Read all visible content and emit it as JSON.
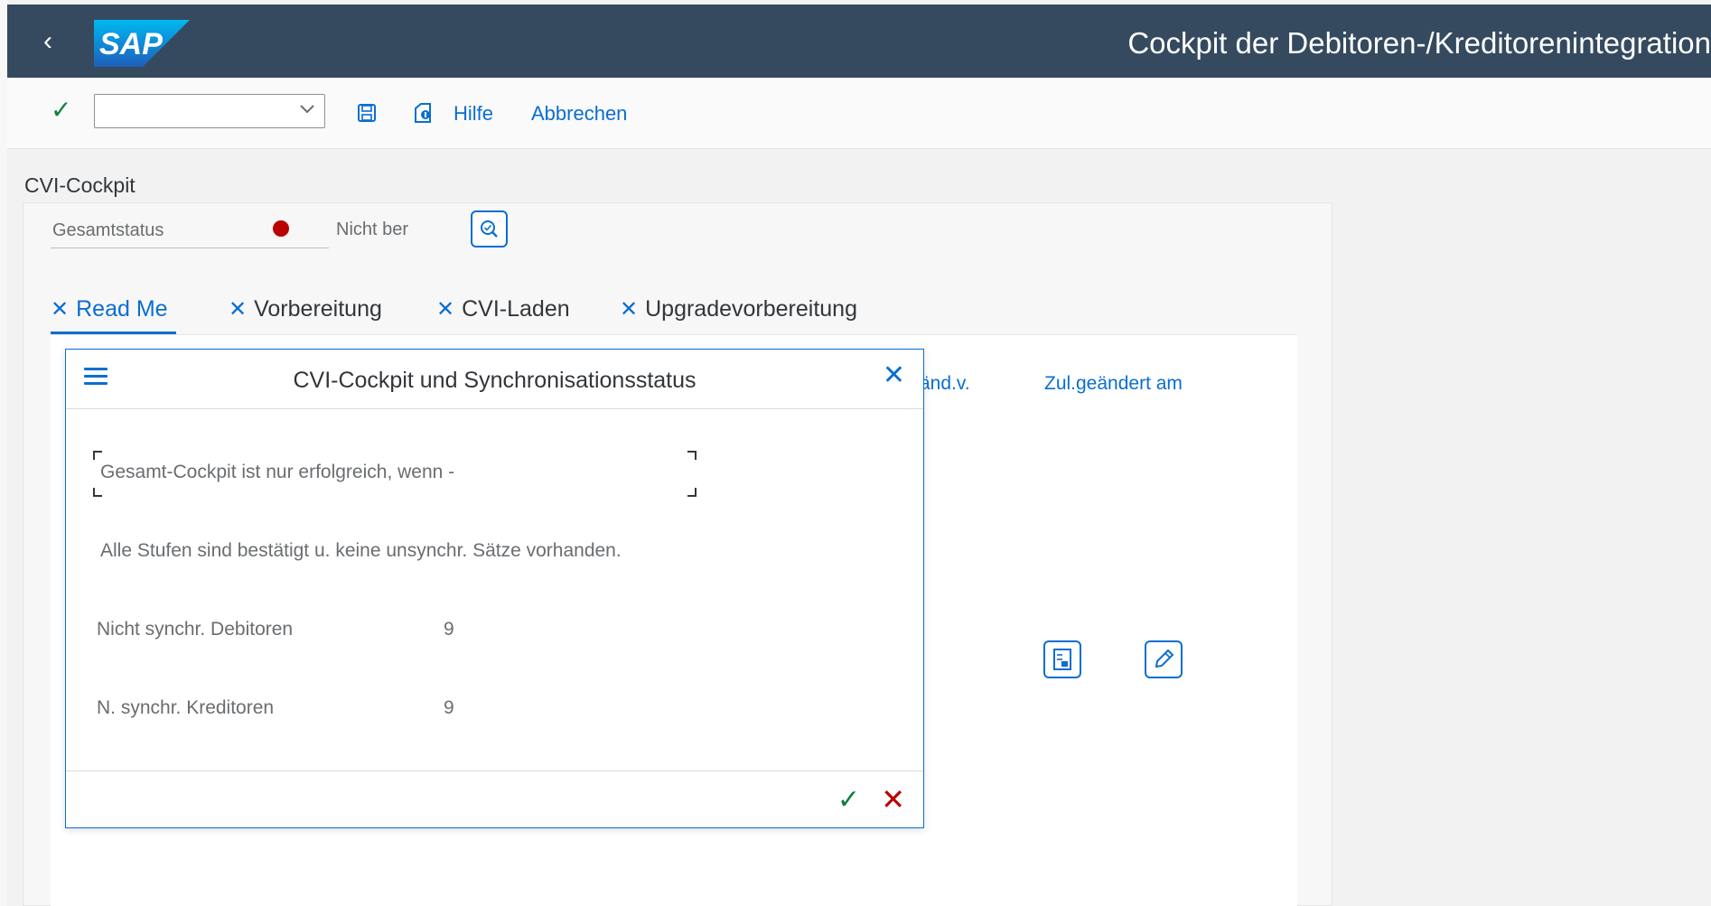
{
  "shell": {
    "brand": "SAP",
    "title": "Cockpit der Debitoren-/Kreditorenintegration",
    "back_glyph": "‹"
  },
  "toolbar": {
    "confirm_glyph": "✓",
    "command_field_value": "",
    "help_label": "Hilfe",
    "cancel_label": "Abbrechen"
  },
  "page": {
    "heading": "CVI-Cockpit"
  },
  "status": {
    "label": "Gesamtstatus",
    "value": "Nicht ber",
    "indicator_color": "#bb0000"
  },
  "tabs": [
    {
      "label": "Read Me",
      "active": true
    },
    {
      "label": "Vorbereitung",
      "active": false
    },
    {
      "label": "CVI-Laden",
      "active": false
    },
    {
      "label": "Upgradevorbereitung",
      "active": false
    }
  ],
  "table": {
    "col_changed_by": "änd.v.",
    "col_changed_on": "Zul.geändert am"
  },
  "dialog": {
    "title": "CVI-Cockpit und Synchronisationsstatus",
    "close_glyph": "✕",
    "line1": "Gesamt-Cockpit ist nur erfolgreich, wenn -",
    "line2": "Alle Stufen sind bestätigt u. keine unsynchr. Sätze vorhanden.",
    "rows": [
      {
        "label": "Nicht synchr. Debitoren",
        "value": "9"
      },
      {
        "label": "N. synchr. Kreditoren",
        "value": "9"
      }
    ],
    "ok_glyph": "✓",
    "cancel_glyph": "✕"
  },
  "colors": {
    "shell_bg": "#354a5f",
    "accent": "#0a6ed1",
    "positive": "#107e3e",
    "negative": "#bb0000"
  },
  "icons": [
    "back-icon",
    "sap-logo",
    "checkmark-icon",
    "chevron-down-icon",
    "save-icon",
    "help-icon",
    "inspect-icon",
    "tab-close-icon",
    "menu-icon",
    "close-icon",
    "display-icon",
    "edit-icon",
    "accept-icon",
    "reject-icon"
  ]
}
